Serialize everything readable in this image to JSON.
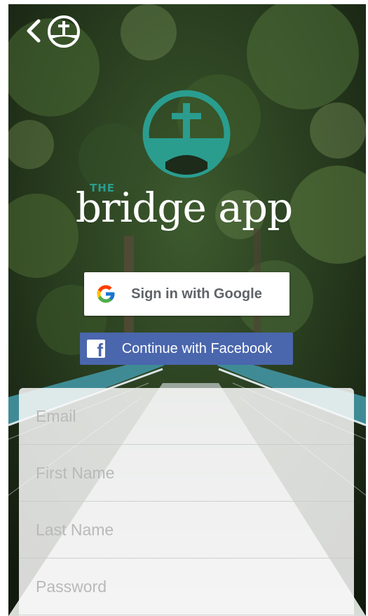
{
  "header": {
    "back_icon": "chevron-left-icon",
    "logo_icon": "cross-bridge-logo-icon"
  },
  "brand": {
    "prefix": "THE",
    "name": "bridge app",
    "logo_color": "#2a9d8f"
  },
  "social": {
    "google_label": "Sign in with Google",
    "google_icon": "google-g-icon",
    "facebook_label": "Continue with Facebook",
    "facebook_icon": "facebook-f-icon",
    "facebook_color": "#4a66ad"
  },
  "form": {
    "fields": [
      {
        "placeholder": "Email",
        "value": ""
      },
      {
        "placeholder": "First Name",
        "value": ""
      },
      {
        "placeholder": "Last Name",
        "value": ""
      },
      {
        "placeholder": "Password",
        "value": ""
      }
    ]
  }
}
